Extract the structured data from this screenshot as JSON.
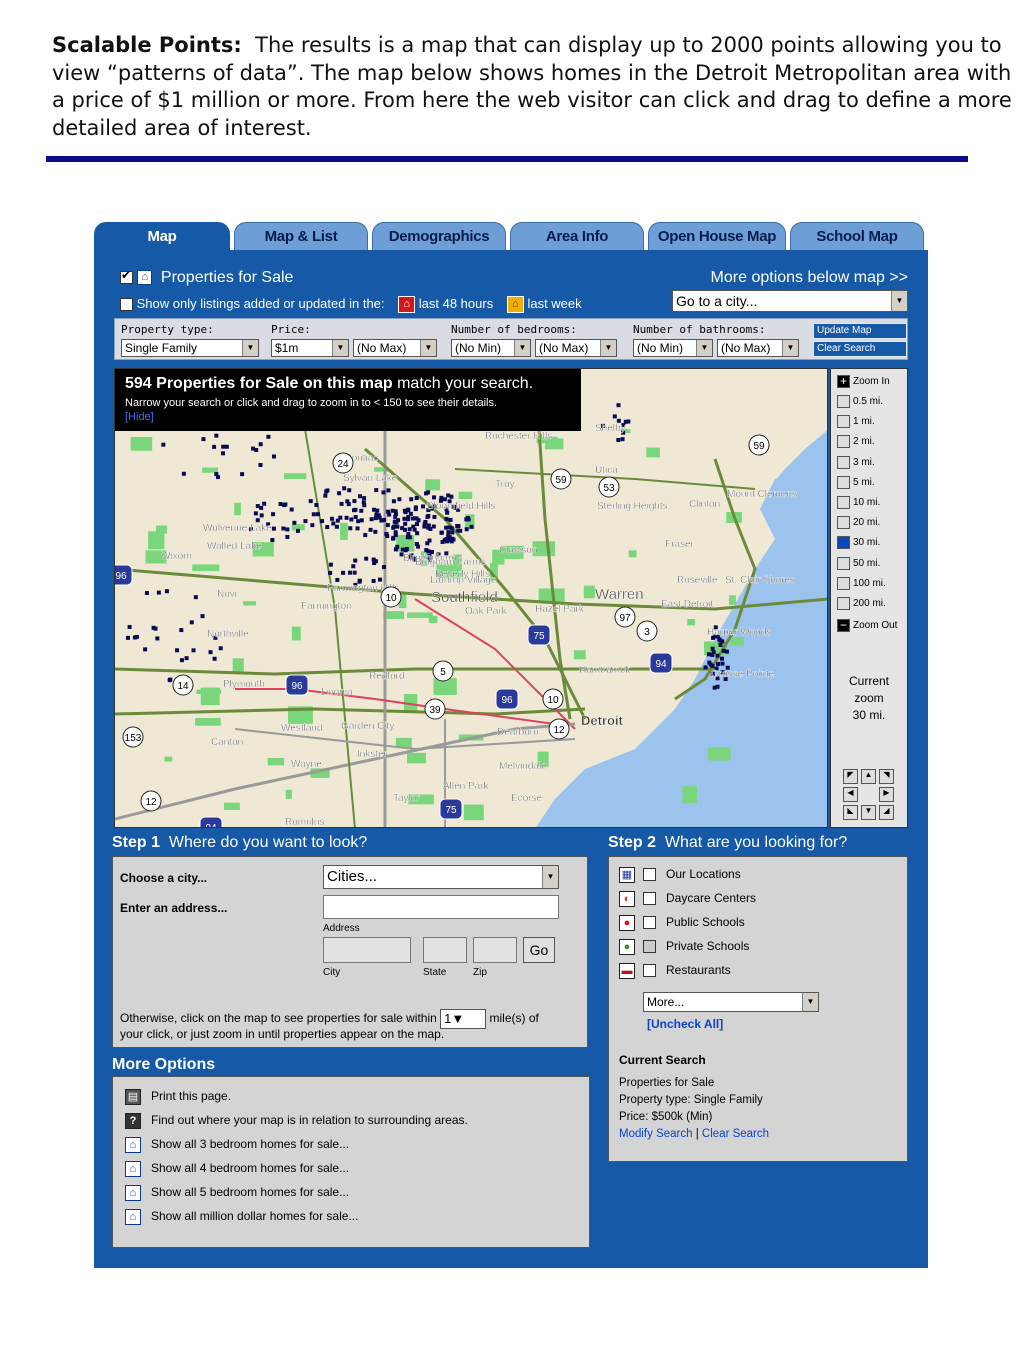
{
  "intro": {
    "heading": "Scalable Points:",
    "body": "The results is a map that can display up to 2000 points allowing you to view “patterns of data”.  The map below shows homes in the Detroit Metropolitan area with a price of $1 million or more.  From here the web visitor can click and drag to define a more detailed area of interest."
  },
  "tabs": [
    {
      "label": "Map",
      "active": true
    },
    {
      "label": "Map & List"
    },
    {
      "label": "Demographics"
    },
    {
      "label": "Area Info"
    },
    {
      "label": "Open House Map"
    },
    {
      "label": "School Map"
    }
  ],
  "header": {
    "properties_label": "Properties for Sale",
    "more_options_link": "More options below map >>",
    "show_only_label": "Show only listings added or updated in the:",
    "last48": "last 48 hours",
    "lastweek": "last week",
    "city_select": "Go to a city..."
  },
  "filters": {
    "property_type_label": "Property type:",
    "property_type_value": "Single Family",
    "price_label": "Price:",
    "price_min": "$1m",
    "price_max": "(No Max)",
    "bedrooms_label": "Number of bedrooms:",
    "bed_min": "(No Min)",
    "bed_max": "(No Max)",
    "bathrooms_label": "Number of bathrooms:",
    "bath_min": "(No Min)",
    "bath_max": "(No Max)",
    "update_button": "Update Map",
    "clear_button": "Clear Search"
  },
  "banner": {
    "count_bold": "594 Properties for Sale on this map",
    "count_rest": " match your search.",
    "sub": "Narrow your search or click and drag to zoom in to < 150 to see their details.",
    "hide": "[Hide]"
  },
  "map_labels": {
    "cities": [
      "Auburn Hills",
      "Rochester Hills",
      "Shelby",
      "Pontiac",
      "Sylvan Lake",
      "Troy",
      "Utica",
      "Sterling Heights",
      "Clinton",
      "Mount Clemens",
      "Bloomfield Hills",
      "Wolverine Lake",
      "Walled Lake",
      "Wixom",
      "Clawson",
      "Fraser",
      "Birmingham",
      "Beverly Hills",
      "Bingham Farms",
      "Lathrup Village",
      "Southfield",
      "Warren",
      "Roseville",
      "St. Clair Shores",
      "Novi",
      "Farmington Hills",
      "Farmington",
      "Oak Park",
      "Hazel Park",
      "East Detroit",
      "Northville",
      "Harper Woods",
      "Hamtramck",
      "Grosse Pointe",
      "Plymouth",
      "Livonia",
      "Redford",
      "Westland",
      "Garden City",
      "Canton",
      "Inkster",
      "Dearborn",
      "Detroit",
      "Wayne",
      "Melvindale",
      "Allen Park",
      "Taylor",
      "Ecorse",
      "Romulus"
    ],
    "shields": [
      "59",
      "59",
      "53",
      "24",
      "10",
      "97",
      "3",
      "75",
      "94",
      "14",
      "96",
      "5",
      "96",
      "10",
      "12",
      "39",
      "153",
      "12",
      "75",
      "94",
      "96"
    ]
  },
  "zoom": {
    "zoom_in": "Zoom In",
    "levels": [
      "0.5 mi.",
      "1 mi.",
      "2 mi.",
      "3 mi.",
      "5 mi.",
      "10 mi.",
      "20 mi.",
      "30 mi.",
      "50 mi.",
      "100 mi.",
      "200 mi."
    ],
    "selected_level": "30 mi.",
    "zoom_out": "Zoom Out",
    "current_label_1": "Current",
    "current_label_2": "zoom",
    "current_value": "30 mi."
  },
  "step1": {
    "title_num": "Step 1",
    "title_text": "Where do you want to look?",
    "choose_city": "Choose a city...",
    "city_select": "Cities...",
    "enter_address": "Enter an address...",
    "address_caption": "Address",
    "city_caption": "City",
    "state_caption": "State",
    "zip_caption": "Zip",
    "go": "Go",
    "otherwise_1": "Otherwise, click on the map to see properties for sale within",
    "radius_value": "1",
    "otherwise_2": "mile(s) of",
    "otherwise_3": "your click, or just zoom in until properties appear on the map."
  },
  "more_options": {
    "title": "More Options",
    "items": [
      {
        "icon": "printer-icon",
        "label": "Print this page."
      },
      {
        "icon": "question-icon",
        "label": "Find out where your map is in relation to surrounding areas."
      },
      {
        "icon": "home-icon",
        "label": "Show all 3 bedroom homes for sale..."
      },
      {
        "icon": "home-icon",
        "label": "Show all 4 bedroom homes for sale..."
      },
      {
        "icon": "home-icon",
        "label": "Show all 5 bedroom homes for sale..."
      },
      {
        "icon": "home-icon",
        "label": "Show all million dollar homes for sale..."
      }
    ]
  },
  "step2": {
    "title_num": "Step 2",
    "title_text": "What are you looking for?",
    "items": [
      "Our Locations",
      "Daycare Centers",
      "Public Schools",
      "Private Schools",
      "Restaurants"
    ],
    "more_select": "More...",
    "uncheck_all": "[Uncheck All]",
    "current_search_title": "Current Search",
    "current_1": "Properties for Sale",
    "current_2": "Property type: Single Family",
    "current_3": "Price: $500k (Min)",
    "modify": "Modify Search",
    "separator": "|",
    "clear": "Clear Search"
  },
  "colors": {
    "app_blue": "#1659a6",
    "tab_blue": "#6d9fd6",
    "rule": "#0b0b8a",
    "dots": "#0a0a55"
  }
}
